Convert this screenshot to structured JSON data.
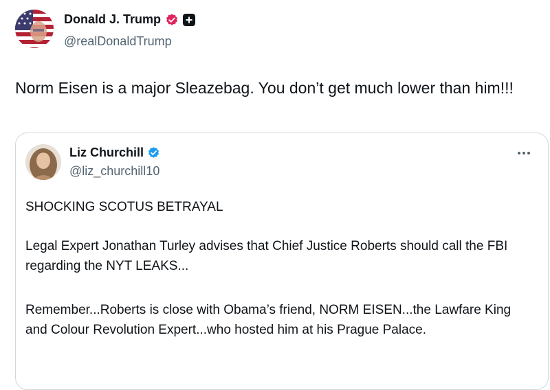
{
  "post": {
    "author_name": "Donald J. Trump",
    "author_handle": "@realDonaldTrump",
    "avatar_icon": "american-flag-avatar",
    "verified_badge_color": "#e0245e",
    "affiliation_icon": "plus-badge-icon",
    "text": "Norm Eisen is a major Sleazebag. You don’t get much lower than him!!!"
  },
  "quote": {
    "author_name": "Liz Churchill",
    "author_handle": "@liz_churchill10",
    "verified_badge_color": "#1d9bf0",
    "more_icon": "more-options-icon",
    "paragraphs": [
      "SHOCKING SCOTUS BETRAYAL",
      "Legal Expert Jonathan Turley advises that Chief Justice Roberts should call the FBI regarding the NYT LEAKS...",
      "Remember...Roberts is close with Obama’s friend, NORM EISEN...the Lawfare King and Colour Revolution Expert...who hosted him at his Prague Palace."
    ]
  }
}
